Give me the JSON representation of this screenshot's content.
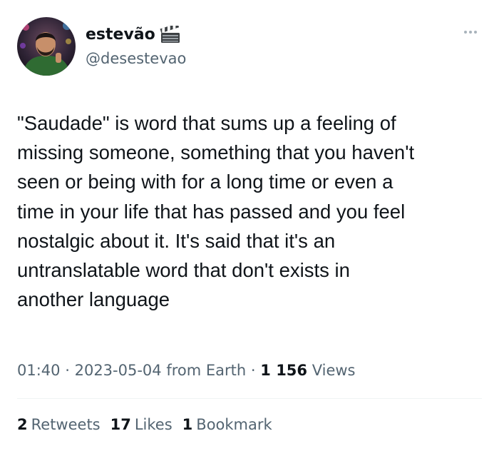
{
  "author": {
    "display_name": "estevão",
    "handle": "@desestevao",
    "name_emoji_icon": "clapper-board-icon"
  },
  "tweet": {
    "text": "\"Saudade\" is word that sums up a feeling of\nmissing someone, something that you haven't\nseen or being with for a long time or even a\ntime in your life that has passed and you feel\nnostalgic about it. It's said that it's an\nuntranslatable word that don't exists in\nanother language",
    "time": "01:40",
    "date": "2023-05-04",
    "source": "from Earth",
    "separator": "·",
    "views_count": "1 156",
    "views_label": "Views"
  },
  "stats": {
    "retweets_count": "2",
    "retweets_label": "Retweets",
    "likes_count": "17",
    "likes_label": "Likes",
    "bookmarks_count": "1",
    "bookmarks_label": "Bookmark"
  },
  "colors": {
    "text_primary": "#0f1419",
    "text_secondary": "#536471",
    "divider": "#eff3f4"
  }
}
